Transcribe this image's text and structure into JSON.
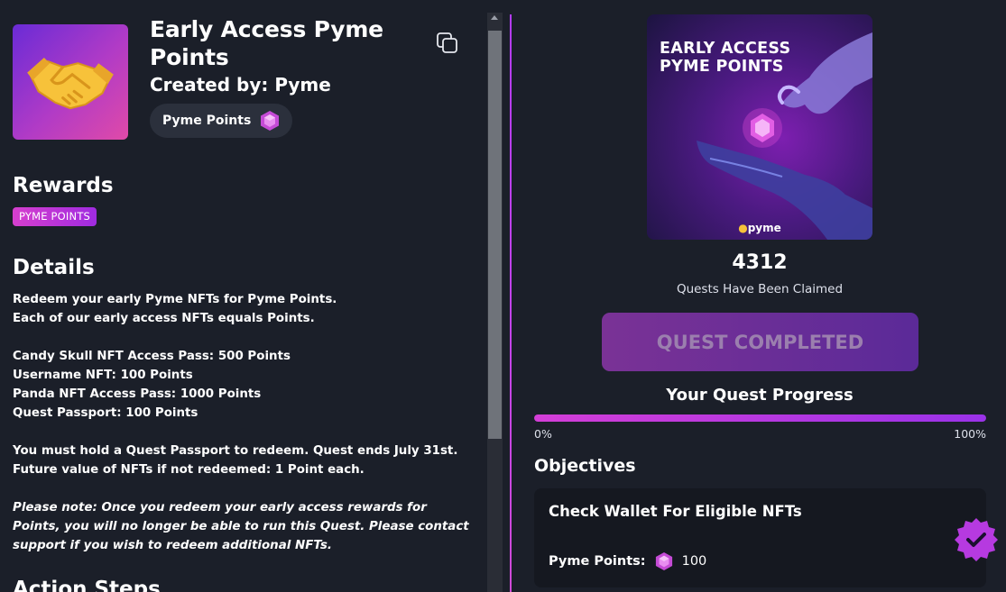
{
  "quest": {
    "title": "Early Access Pyme Points",
    "creator": "Created by: Pyme",
    "points_chip_label": "Pyme Points"
  },
  "rewards": {
    "heading": "Rewards",
    "tag": "PYME POINTS"
  },
  "details": {
    "heading": "Details",
    "line1": "Redeem your early Pyme NFTs for Pyme Points.",
    "line2": "Each of our early access NFTs equals Points.",
    "line3": "Candy Skull NFT Access Pass: 500 Points",
    "line4": "Username NFT: 100 Points",
    "line5": "Panda NFT Access Pass: 1000 Points",
    "line6": "Quest Passport: 100 Points",
    "line7": "You must hold a Quest Passport to redeem. Quest ends July 31st.",
    "line8": "Future value of NFTs if not redeemed: 1 Point each.",
    "note": "Please note: Once you redeem your early access rewards for Points, you will no longer be able to run this Quest. Please contact support if you wish to redeem additional NFTs."
  },
  "action_steps": {
    "heading": "Action Steps"
  },
  "poster": {
    "title_line1": "EARLY ACCESS",
    "title_line2": "PYME POINTS",
    "brand": "pyme"
  },
  "stats": {
    "claim_count": "4312",
    "claim_label": "Quests Have Been Claimed"
  },
  "quest_button": {
    "label": "QUEST COMPLETED"
  },
  "progress": {
    "title": "Your Quest Progress",
    "value_percent": 100,
    "min_label": "0%",
    "max_label": "100%"
  },
  "objectives": {
    "heading": "Objectives",
    "items": [
      {
        "title": "Check Wallet For Eligible NFTs",
        "reward_label": "Pyme Points:",
        "reward_value": "100",
        "completed": true
      }
    ]
  },
  "colors": {
    "background": "#1b1f29",
    "accent_pink": "#d43ed7",
    "accent_purple": "#9a32e8",
    "card": "#151820"
  },
  "icons": {
    "thumbnail": "handshake-icon",
    "copy": "copy-icon",
    "points": "gem-icon",
    "objective_status": "check-badge-icon"
  }
}
